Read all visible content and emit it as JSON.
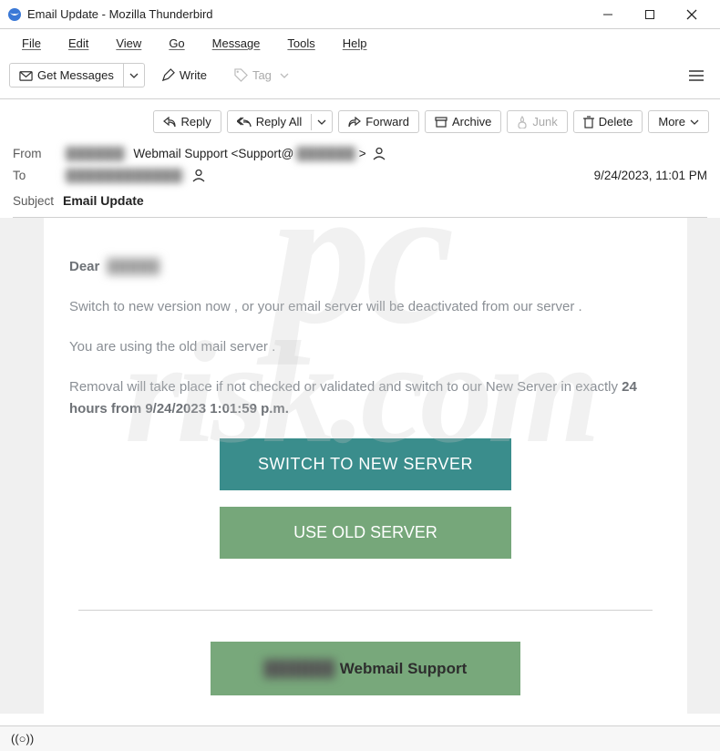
{
  "window": {
    "title": "Email Update - Mozilla Thunderbird"
  },
  "menu": {
    "file": "File",
    "edit": "Edit",
    "view": "View",
    "go": "Go",
    "message": "Message",
    "tools": "Tools",
    "help": "Help"
  },
  "toolbar": {
    "get_messages": "Get Messages",
    "write": "Write",
    "tag": "Tag"
  },
  "actions": {
    "reply": "Reply",
    "reply_all": "Reply All",
    "forward": "Forward",
    "archive": "Archive",
    "junk": "Junk",
    "delete": "Delete",
    "more": "More"
  },
  "header": {
    "from_label": "From",
    "from_redacted1": "██████",
    "from_mid": "Webmail Support <Support@",
    "from_redacted2": "██████",
    "from_end": ">",
    "to_label": "To",
    "to_redacted": "████████████",
    "datetime": "9/24/2023, 11:01 PM",
    "subject_label": "Subject",
    "subject_value": "Email Update"
  },
  "email": {
    "greeting_prefix": "Dear",
    "greeting_name": "█████",
    "p1": "Switch to new version now  , or your email server will be deactivated from our server .",
    "p2": "You  are using the old  mail server .",
    "p3a": "Removal will take place if not checked or validated and switch to our New Server in exactly ",
    "p3b": "24 hours from 9/24/2023 1:01:59 p.m.",
    "cta_switch": "SWITCH TO NEW SERVER",
    "cta_old": "USE OLD SERVER",
    "footer_redacted": "██████",
    "footer_text": " Webmail Support"
  },
  "status": {
    "activity": "((○))"
  },
  "watermark": {
    "l1": "pc",
    "l2": "risk.com"
  }
}
